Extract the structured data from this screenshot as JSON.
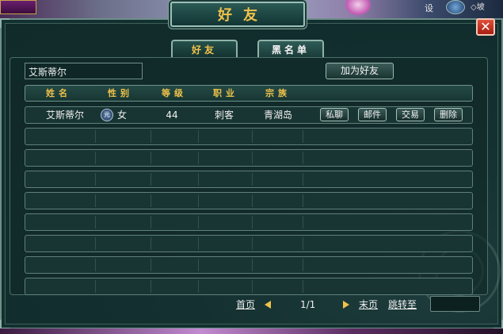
{
  "window": {
    "title": "好友",
    "close_label": "✕"
  },
  "hud": {
    "top_right_label": "设",
    "top_right_text": "◇坡"
  },
  "tabs": [
    {
      "label": "好友",
      "active": true
    },
    {
      "label": "黑名单",
      "active": false
    }
  ],
  "search": {
    "value": "艾斯蒂尔",
    "add_button": "加为好友"
  },
  "columns": [
    "姓名",
    "性别",
    "等级",
    "职业",
    "宗族"
  ],
  "friends": [
    {
      "name": "艾斯蒂尔",
      "gender_icon": "元",
      "gender": "女",
      "level": "44",
      "profession": "刺客",
      "clan": "青湖岛",
      "actions": [
        "私聊",
        "邮件",
        "交易",
        "删除"
      ]
    }
  ],
  "empty_rows": 8,
  "pager": {
    "first": "首页",
    "page": "1/1",
    "last": "末页",
    "jump": "跳转至",
    "jump_value": ""
  },
  "colors": {
    "accent": "#f0c24a",
    "panel": "#123030",
    "close": "#c83a28"
  }
}
